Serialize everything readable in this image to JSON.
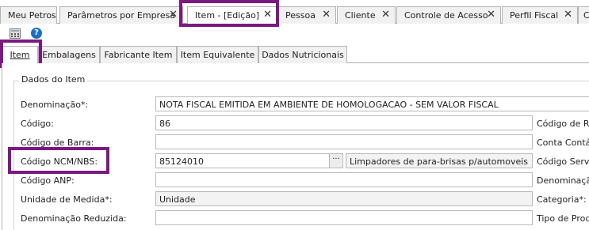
{
  "doc_tabs": [
    {
      "label": "Meu Petros",
      "closable": false
    },
    {
      "label": "Parâmetros por Empresa",
      "closable": true
    },
    {
      "label": "Item - [Edição]",
      "closable": true,
      "active": true
    },
    {
      "label": "Pessoa",
      "closable": true
    },
    {
      "label": "Cliente",
      "closable": true
    },
    {
      "label": "Controle de Acesso",
      "closable": true
    },
    {
      "label": "Perfil Fiscal",
      "closable": true
    },
    {
      "label": "C",
      "closable": false
    }
  ],
  "close_glyph": "✕",
  "toolbar": {
    "icons": [
      "calculator-icon",
      "help-icon"
    ],
    "help_glyph": "?"
  },
  "inner_tabs": [
    {
      "label": "Item",
      "active": true
    },
    {
      "label": "Embalagens"
    },
    {
      "label": "Fabricante Item"
    },
    {
      "label": "Item Equivalente"
    },
    {
      "label": "Dados Nutricionais"
    }
  ],
  "group_title": "Dados do Item",
  "form": {
    "rows": [
      {
        "label": "Denominação*:",
        "value": "NOTA FISCAL EMITIDA EM AMBIENTE DE HOMOLOGACAO - SEM VALOR FISCAL",
        "right_label": ""
      },
      {
        "label": "Código:",
        "value": "86",
        "right_label": "Código de Ref"
      },
      {
        "label": "Código de Barra:",
        "value": "",
        "right_label": "Conta Contáb"
      },
      {
        "label": "Código NCM/NBS:",
        "value": "85124010",
        "lookup_button": "···",
        "description": "Limpadores de para-brisas p/automoveis",
        "right_label": "Código Serviç"
      },
      {
        "label": "Código ANP:",
        "value": "",
        "right_label": "Denominação"
      },
      {
        "label": "Unidade de Medida*:",
        "value": "Unidade",
        "right_label": "Categoria*:"
      },
      {
        "label": "Denominação Reduzida:",
        "value": "",
        "right_label": "Tipo de Produ"
      }
    ]
  },
  "colors": {
    "highlight": "#7a1a80",
    "help_icon": "#1d6fc4"
  }
}
